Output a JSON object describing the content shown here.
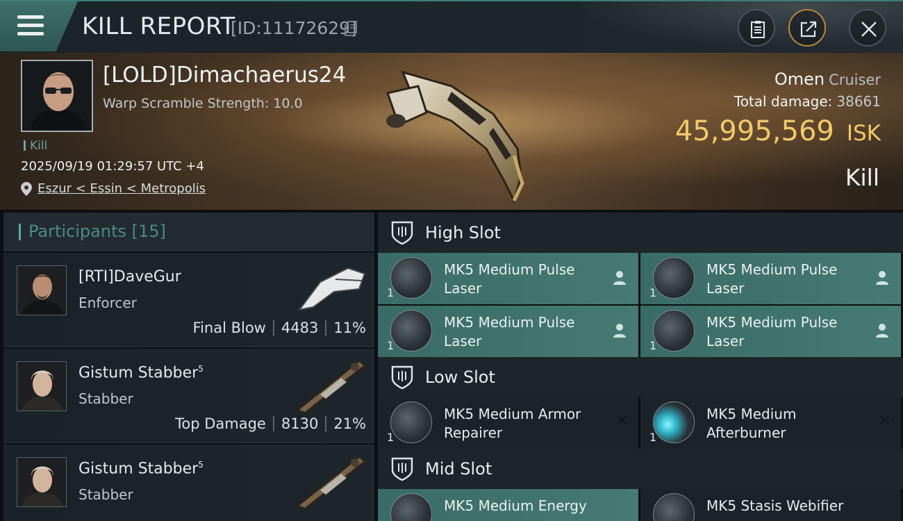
{
  "header": {
    "title": "KILL REPORT",
    "report_id": "[ID:11172629]",
    "buttons": [
      "clipboard-icon",
      "share-icon",
      "close-icon"
    ]
  },
  "victim": {
    "name": "[LOLD]Dimachaerus24",
    "warp_scramble": "Warp Scramble Strength: 10.0",
    "tag": "Kill",
    "datetime": "2025/09/19 01:29:57 UTC +4",
    "location": "Eszur < Essin < Metropolis",
    "ship_name": "Omen",
    "ship_class": "Cruiser",
    "total_damage_label": "Total damage:",
    "total_damage": "38661",
    "isk_value": "45,995,569",
    "isk_unit": "ISK",
    "result": "Kill"
  },
  "participants": {
    "label": "Participants",
    "count": "[15]",
    "rows": [
      {
        "name": "[RTI]DaveGur",
        "level": "",
        "ship": "Enforcer",
        "stat_label": "Final Blow",
        "damage": "4483",
        "percent": "11%"
      },
      {
        "name": "Gistum Stabber",
        "level": "5",
        "ship": "Stabber",
        "stat_label": "Top Damage",
        "damage": "8130",
        "percent": "21%"
      },
      {
        "name": "Gistum Stabber",
        "level": "5",
        "ship": "Stabber",
        "stat_label": "",
        "damage": "",
        "percent": ""
      }
    ]
  },
  "fittings": {
    "high_slot": {
      "label": "High Slot",
      "modules": [
        {
          "name": "MK5 Medium Pulse Laser",
          "qty": "1"
        },
        {
          "name": "MK5 Medium Pulse Laser",
          "qty": "1"
        },
        {
          "name": "MK5 Medium Pulse Laser",
          "qty": "1"
        },
        {
          "name": "MK5 Medium Pulse Laser",
          "qty": "1"
        }
      ]
    },
    "low_slot": {
      "label": "Low Slot",
      "modules": [
        {
          "name": "MK5 Medium Armor Repairer",
          "qty": "1"
        },
        {
          "name": "MK5 Medium Afterburner",
          "qty": "1"
        }
      ]
    },
    "mid_slot": {
      "label": "Mid Slot",
      "modules": [
        {
          "name": "MK5 Medium Energy",
          "qty": ""
        },
        {
          "name": "MK5 Stasis Webifier",
          "qty": ""
        }
      ]
    }
  },
  "colors": {
    "accent": "#3f6f6b",
    "isk": "#f3c96b",
    "module_active": "#477a74"
  }
}
